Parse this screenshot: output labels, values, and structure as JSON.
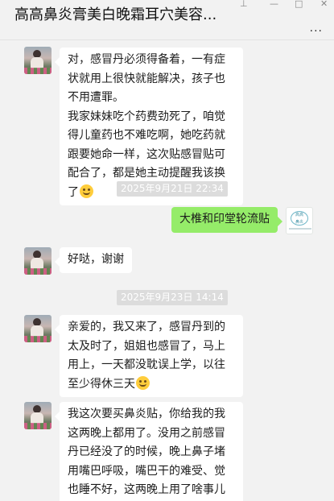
{
  "header": {
    "title": "高高鼻炎膏美白晚霜耳穴美容...",
    "controls": [
      "pin-icon",
      "minimize-icon",
      "maximize-icon",
      "close-icon"
    ],
    "more_icon": "more-icon"
  },
  "messages": [
    {
      "sender": "contact",
      "text": "对，感冒丹必须得备着，一有症状就用上很快就能解决，孩子也不用遭罪。\n我家妹妹吃个药费劲死了，咱觉得儿童药也不难吃啊，她吃药就跟要她命一样，这次贴感冒贴可配合了，都是她主动提醒我该换了",
      "emoji": "thinking-face-emoji"
    },
    {
      "timestamp": "2025年9月21日 22:34"
    },
    {
      "sender": "me",
      "text": "大椎和印堂轮流贴"
    },
    {
      "sender": "contact",
      "text": "好哒，谢谢"
    },
    {
      "timestamp": "2025年9月23日 14:14"
    },
    {
      "sender": "contact",
      "text": "亲爱的，我又来了，感冒丹到的太及时了，姐姐也感冒了，马上用上，一天都没耽误上学，以往至少得休三天",
      "emoji": "thinking-face-emoji"
    },
    {
      "sender": "contact",
      "text": "我这次要买鼻炎贴，你给我的我这两晚上都用了。没用之前感冒丹已经没了的时候，晚上鼻子堵用嘴巴呼吸，嘴巴干的难受、觉也睡不好，这两晚上用了啥事儿都没有，一觉睡到被闹钟叫醒",
      "emoji": "grinning-face-emoji"
    }
  ],
  "colors": {
    "background": "#f2f2f2",
    "bubble_in": "#ffffff",
    "bubble_out": "#95ec69",
    "timestamp_bg": "#dcdcdc"
  }
}
